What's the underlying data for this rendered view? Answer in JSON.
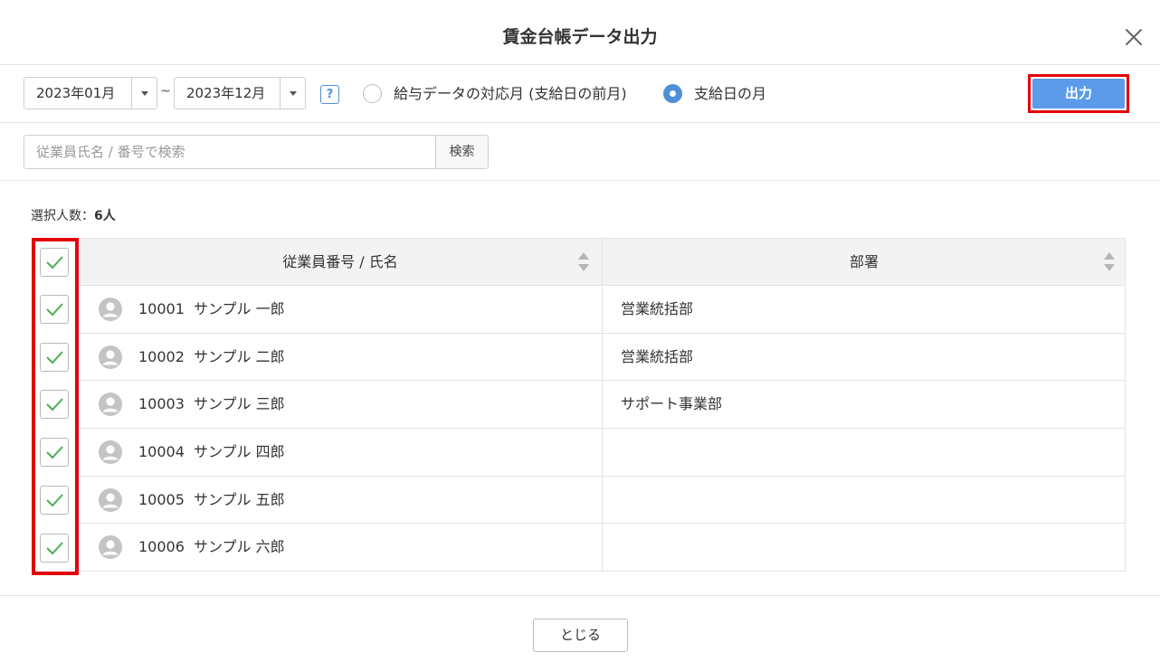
{
  "dialog": {
    "title": "賃金台帳データ出力"
  },
  "toolbar": {
    "from_month": "2023年01月",
    "range_separator": "~",
    "to_month": "2023年12月",
    "help_label": "?",
    "radio_option_1": "給与データの対応月 (支給日の前月)",
    "radio_option_2": "支給日の月",
    "selected_option": "支給日の月",
    "output_label": "出力"
  },
  "search": {
    "placeholder": "従業員氏名 / 番号で検索",
    "value": "",
    "button_label": "検索"
  },
  "selection": {
    "label": "選択人数：",
    "count": "6人"
  },
  "table": {
    "columns": [
      "従業員番号 / 氏名",
      "部署"
    ],
    "rows": [
      {
        "id": "10001",
        "name": "サンプル 一郎",
        "dept": "営業統括部",
        "checked": true
      },
      {
        "id": "10002",
        "name": "サンプル 二郎",
        "dept": "営業統括部",
        "checked": true
      },
      {
        "id": "10003",
        "name": "サンプル 三郎",
        "dept": "サポート事業部",
        "checked": true
      },
      {
        "id": "10004",
        "name": "サンプル 四郎",
        "dept": "",
        "checked": true
      },
      {
        "id": "10005",
        "name": "サンプル 五郎",
        "dept": "",
        "checked": true
      },
      {
        "id": "10006",
        "name": "サンプル 六郎",
        "dept": "",
        "checked": true
      }
    ]
  },
  "footer": {
    "close_label": "とじる"
  },
  "colors": {
    "accent": "#5b9bea",
    "highlight": "#e3000b",
    "check": "#4caf50"
  }
}
